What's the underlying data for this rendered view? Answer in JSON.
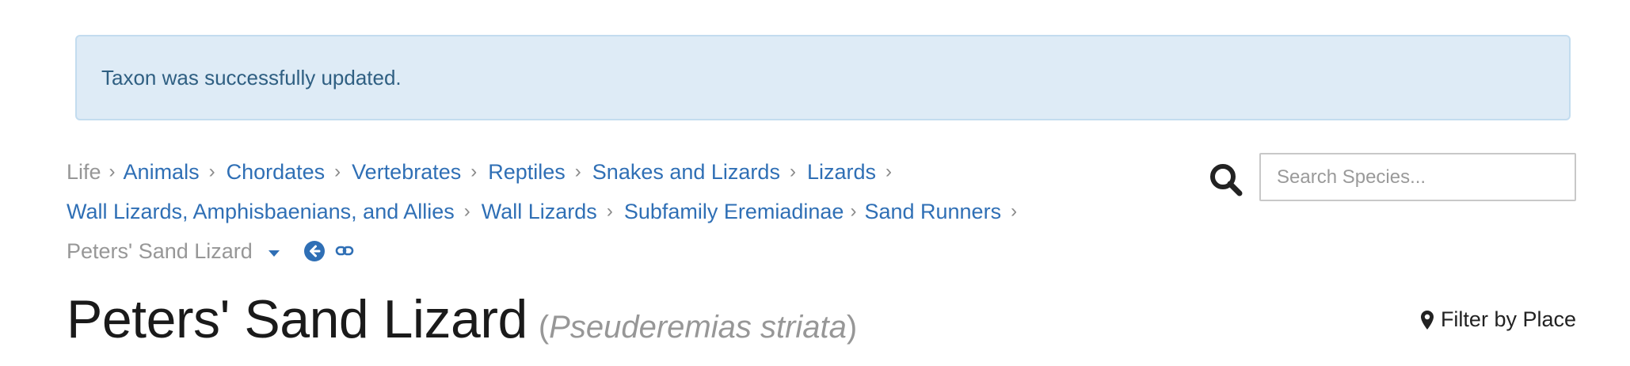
{
  "alert": {
    "message": "Taxon was successfully updated."
  },
  "breadcrumb": {
    "root": "Life",
    "rows": [
      [
        "Animals",
        "Chordates",
        "Vertebrates",
        "Reptiles",
        "Snakes and Lizards",
        "Lizards"
      ],
      [
        "Wall Lizards, Amphisbaenians, and Allies",
        "Wall Lizards",
        "Subfamily Eremiadinae",
        "Sand Runners"
      ]
    ],
    "current": "Peters' Sand Lizard",
    "separator": "›"
  },
  "search": {
    "placeholder": "Search Species..."
  },
  "header": {
    "common_name": "Peters' Sand Lizard",
    "scientific_name": "Pseuderemias striata",
    "paren_open": "(",
    "paren_close": ")"
  },
  "filter": {
    "label": "Filter by Place"
  },
  "colors": {
    "link": "#2f6fb5",
    "alert_bg": "#deebf6",
    "alert_text": "#2f5f82",
    "muted": "#979797"
  },
  "icons": {
    "search": "search-icon",
    "back": "circle-arrow-left-icon",
    "link": "link-icon",
    "pin": "map-pin-icon",
    "caret": "caret-down-icon"
  }
}
